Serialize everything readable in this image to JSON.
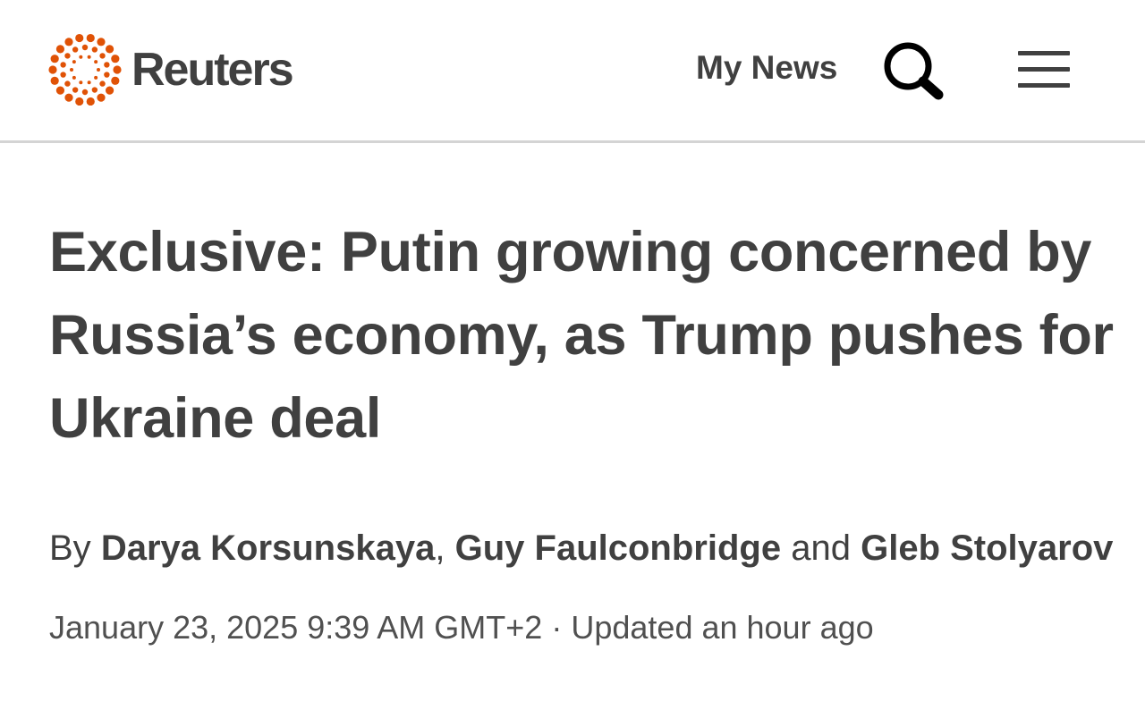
{
  "header": {
    "logo_text": "Reuters",
    "my_news_label": "My News",
    "search_icon": "search-icon",
    "menu_icon": "hamburger-menu-icon",
    "brand_color": "#e05206",
    "text_color": "#404040"
  },
  "article": {
    "headline": "Exclusive: Putin growing concerned by Russia’s economy, as Trump pushes for Ukraine deal",
    "byline": {
      "prefix": "By",
      "authors": [
        "Darya Korsunskaya",
        "Guy Faulconbridge",
        "Gleb Stolyarov"
      ],
      "separator": ",",
      "conjunction": "and"
    },
    "date": "January 23, 2025 9:39 AM GMT+2",
    "date_separator": "·",
    "updated": "Updated an hour ago"
  }
}
